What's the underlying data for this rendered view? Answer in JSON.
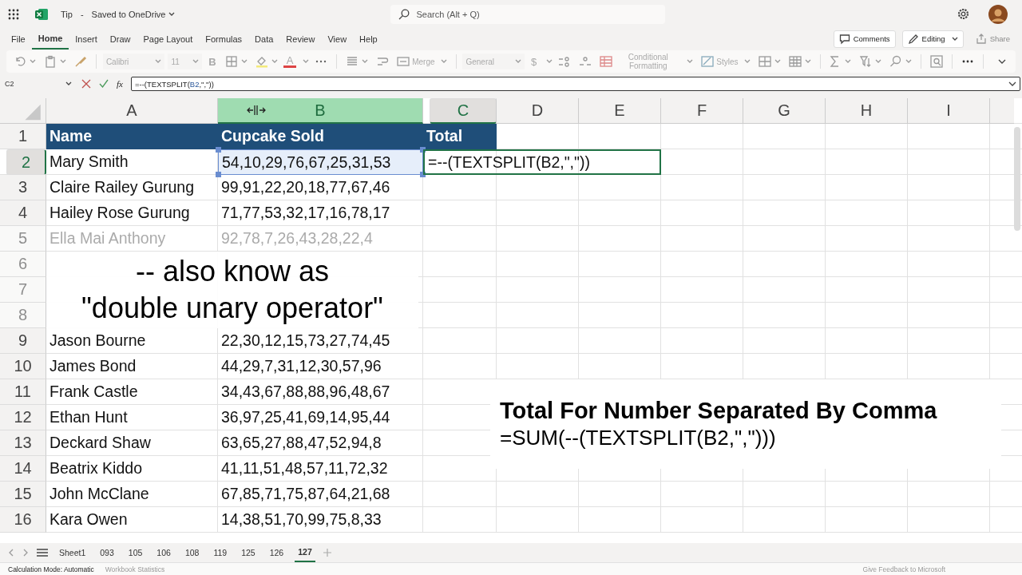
{
  "title_bar": {
    "file_name": "Tip",
    "separator": "-",
    "save_status": "Saved to OneDrive",
    "search_placeholder": "Search (Alt + Q)"
  },
  "menu_tabs": [
    {
      "label": "File",
      "selected": false
    },
    {
      "label": "Home",
      "selected": true
    },
    {
      "label": "Insert",
      "selected": false
    },
    {
      "label": "Draw",
      "selected": false
    },
    {
      "label": "Page Layout",
      "selected": false
    },
    {
      "label": "Formulas",
      "selected": false
    },
    {
      "label": "Data",
      "selected": false
    },
    {
      "label": "Review",
      "selected": false
    },
    {
      "label": "View",
      "selected": false
    },
    {
      "label": "Help",
      "selected": false
    }
  ],
  "actions": [
    {
      "label": "Comments",
      "disabled": false
    },
    {
      "label": "Editing",
      "disabled": false
    },
    {
      "label": "Share",
      "disabled": true
    }
  ],
  "ribbon": {
    "font": "Calibri",
    "size": "11",
    "bold": "B",
    "font_color": "A",
    "merge": "Merge",
    "number_format": "General",
    "currency": "$",
    "conditional_formatting": "Conditional Formatting",
    "styles": "Styles"
  },
  "formula_bar": {
    "name_box": "C2",
    "fx": "fx",
    "formula": [
      {
        "text": "=--(TEXTSPLIT(",
        "ref": false
      },
      {
        "text": "B2",
        "ref": true
      },
      {
        "text": ",\",\"))",
        "ref": false
      }
    ]
  },
  "columns": [
    {
      "label": "A",
      "selected": false,
      "active": false
    },
    {
      "label": "B",
      "selected": true,
      "active": false
    },
    {
      "label": "C",
      "selected": false,
      "active": true
    },
    {
      "label": "D",
      "selected": false,
      "active": false
    },
    {
      "label": "E",
      "selected": false,
      "active": false
    },
    {
      "label": "F",
      "selected": false,
      "active": false
    },
    {
      "label": "G",
      "selected": false,
      "active": false
    },
    {
      "label": "H",
      "selected": false,
      "active": false
    },
    {
      "label": "I",
      "selected": false,
      "active": false
    }
  ],
  "rows": [
    {
      "number": "1",
      "kind": "header",
      "active": false,
      "faded": false,
      "cells": [
        "Name",
        "Cupcake Sold",
        "Total"
      ]
    },
    {
      "number": "2",
      "kind": "data",
      "active": true,
      "faded": false,
      "cells": [
        "Mary Smith",
        "54,10,29,76,67,25,31,53"
      ],
      "editing": [
        {
          "text": "=--(TEXTSPLIT(B2,\",\"))"
        }
      ]
    },
    {
      "number": "3",
      "kind": "data",
      "active": false,
      "faded": false,
      "cells": [
        "Claire Railey Gurung",
        "99,91,22,20,18,77,67,46"
      ]
    },
    {
      "number": "4",
      "kind": "data",
      "active": false,
      "faded": false,
      "cells": [
        "Hailey Rose Gurung",
        "71,77,53,32,17,16,78,17"
      ]
    },
    {
      "number": "5",
      "kind": "data",
      "active": false,
      "faded": true,
      "cells": [
        "Ella Mai Anthony",
        "92,78,7,26,43,28,22,4"
      ]
    },
    {
      "number": "6",
      "kind": "data",
      "active": false,
      "faded": true,
      "cells": []
    },
    {
      "number": "7",
      "kind": "data",
      "active": false,
      "faded": true,
      "cells": []
    },
    {
      "number": "8",
      "kind": "data",
      "active": false,
      "faded": true,
      "cells": []
    },
    {
      "number": "9",
      "kind": "data",
      "active": false,
      "faded": false,
      "cells": [
        "Jason Bourne",
        "22,30,12,15,73,27,74,45"
      ]
    },
    {
      "number": "10",
      "kind": "data",
      "active": false,
      "faded": false,
      "cells": [
        "James Bond",
        "44,29,7,31,12,30,57,96"
      ]
    },
    {
      "number": "11",
      "kind": "data",
      "active": false,
      "faded": false,
      "cells": [
        "Frank Castle",
        "34,43,67,88,88,96,48,67"
      ]
    },
    {
      "number": "12",
      "kind": "data",
      "active": false,
      "faded": false,
      "cells": [
        "Ethan Hunt",
        "36,97,25,41,69,14,95,44"
      ]
    },
    {
      "number": "13",
      "kind": "data",
      "active": false,
      "faded": false,
      "cells": [
        "Deckard Shaw",
        "63,65,27,88,47,52,94,8"
      ]
    },
    {
      "number": "14",
      "kind": "data",
      "active": false,
      "faded": false,
      "cells": [
        "Beatrix Kiddo",
        "41,11,51,48,57,11,72,32"
      ]
    },
    {
      "number": "15",
      "kind": "data",
      "active": false,
      "faded": false,
      "cells": [
        "John McClane",
        "67,85,71,75,87,64,21,68"
      ]
    },
    {
      "number": "16",
      "kind": "data",
      "active": false,
      "faded": false,
      "cells": [
        "Kara Owen",
        "14,38,51,70,99,75,8,33"
      ]
    }
  ],
  "captions": [
    {
      "lines": [
        "-- also know as",
        "\"double unary operator\""
      ]
    },
    {
      "heading": "Total For Number Separated By Comma",
      "formula": "=SUM(--(TEXTSPLIT(B2,\",\")))"
    }
  ],
  "sheet_tabs": [
    {
      "label": "Sheet1",
      "selected": false
    },
    {
      "label": "093",
      "selected": false
    },
    {
      "label": "105",
      "selected": false
    },
    {
      "label": "106",
      "selected": false
    },
    {
      "label": "108",
      "selected": false
    },
    {
      "label": "119",
      "selected": false
    },
    {
      "label": "125",
      "selected": false
    },
    {
      "label": "126",
      "selected": false
    },
    {
      "label": "127",
      "selected": true
    }
  ],
  "status_bar": {
    "calculation_mode": "Calculation Mode: Automatic",
    "statistics": "Workbook Statistics",
    "feedback": "Give Feedback to Microsoft"
  }
}
